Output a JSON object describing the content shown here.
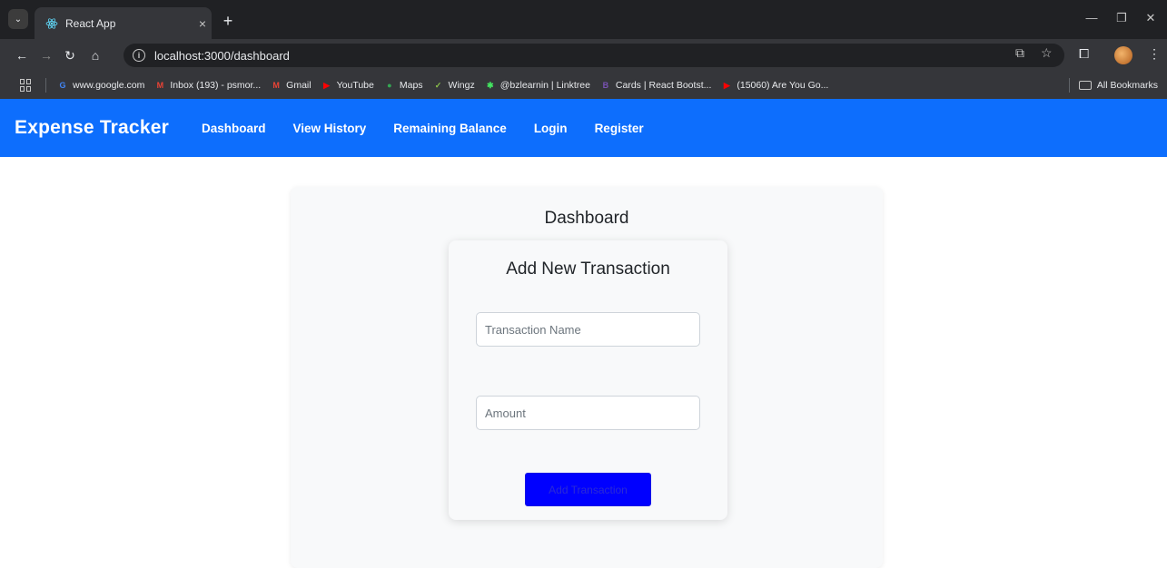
{
  "browser": {
    "tab": {
      "title": "React App",
      "close": "×"
    },
    "new_tab": "+",
    "window_controls": {
      "minimize": "—",
      "restore": "❐",
      "close": "✕"
    },
    "url": "localhost:3000/dashboard",
    "bookmarks": [
      {
        "label": "www.google.com",
        "icon": "google-icon",
        "color": "#4285f4",
        "glyph": "G"
      },
      {
        "label": "Inbox (193) - psmor...",
        "icon": "gmail-icon",
        "color": "#ea4335",
        "glyph": "M"
      },
      {
        "label": "Gmail",
        "icon": "gmail-icon",
        "color": "#ea4335",
        "glyph": "M"
      },
      {
        "label": "YouTube",
        "icon": "youtube-icon",
        "color": "#ff0000",
        "glyph": "▶"
      },
      {
        "label": "Maps",
        "icon": "maps-icon",
        "color": "#34a853",
        "glyph": "●"
      },
      {
        "label": "Wingz",
        "icon": "wingz-icon",
        "color": "#8bc34a",
        "glyph": "✓"
      },
      {
        "label": "@bzlearnin | Linktree",
        "icon": "linktree-icon",
        "color": "#43e660",
        "glyph": "✱"
      },
      {
        "label": "Cards | React Bootst...",
        "icon": "bootstrap-icon",
        "color": "#7952b3",
        "glyph": "B"
      },
      {
        "label": "(15060) Are You Go...",
        "icon": "youtube-icon",
        "color": "#ff0000",
        "glyph": "▶"
      }
    ],
    "all_bookmarks": "All Bookmarks"
  },
  "app": {
    "brand": "Expense Tracker",
    "nav": [
      "Dashboard",
      "View History",
      "Remaining Balance",
      "Login",
      "Register"
    ],
    "dashboard_title": "Dashboard",
    "form": {
      "title": "Add New Transaction",
      "name_placeholder": "Transaction Name",
      "amount_placeholder": "Amount",
      "submit_label": "Add Transaction"
    }
  },
  "colors": {
    "navbar": "#0d6efd",
    "submit_button": "#0000ff",
    "card_background": "#f8f9fa"
  }
}
